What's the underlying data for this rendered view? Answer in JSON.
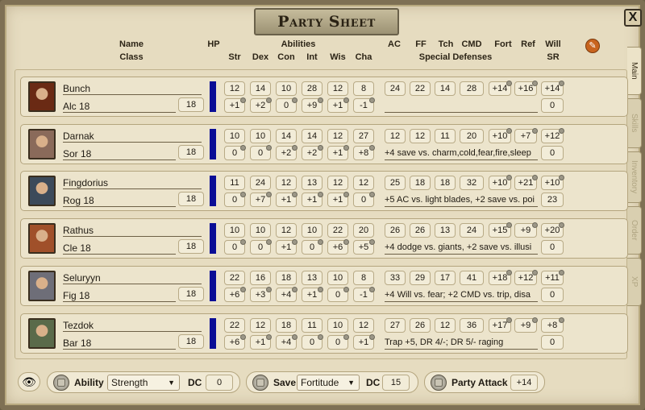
{
  "window": {
    "title": "Party Sheet",
    "close_label": "X"
  },
  "headers": {
    "name": "Name",
    "class": "Class",
    "hp": "HP",
    "abilities": "Abilities",
    "ability_cols": [
      "Str",
      "Dex",
      "Con",
      "Int",
      "Wis",
      "Cha"
    ],
    "ac": "AC",
    "ff": "FF",
    "tch": "Tch",
    "cmd": "CMD",
    "fort": "Fort",
    "ref": "Ref",
    "will": "Will",
    "special_defenses": "Special Defenses",
    "sr": "SR"
  },
  "tabs": [
    "Main",
    "Skills",
    "Inventory",
    "Order",
    "XP"
  ],
  "active_tab": "Main",
  "colors": {
    "hp_bar": "#0a0d96",
    "edit_button": "#c8641e"
  },
  "party": [
    {
      "name": "Bunch",
      "class": "Alc 18",
      "level": "18",
      "scores": [
        "12",
        "14",
        "10",
        "28",
        "12",
        "8"
      ],
      "mods": [
        "+1",
        "+2",
        "0",
        "+9",
        "+1",
        "-1"
      ],
      "ac": "24",
      "ff": "22",
      "tch": "14",
      "cmd": "28",
      "fort": "+14",
      "ref": "+16",
      "will": "+14",
      "special": "",
      "sr": "0"
    },
    {
      "name": "Darnak",
      "class": "Sor 18",
      "level": "18",
      "scores": [
        "10",
        "10",
        "14",
        "14",
        "12",
        "27"
      ],
      "mods": [
        "0",
        "0",
        "+2",
        "+2",
        "+1",
        "+8"
      ],
      "ac": "12",
      "ff": "12",
      "tch": "11",
      "cmd": "20",
      "fort": "+10",
      "ref": "+7",
      "will": "+12",
      "special": "+4 save vs. charm,cold,fear,fire,sleep",
      "sr": "0"
    },
    {
      "name": "Fingdorius",
      "class": "Rog 18",
      "level": "18",
      "scores": [
        "11",
        "24",
        "12",
        "13",
        "12",
        "12"
      ],
      "mods": [
        "0",
        "+7",
        "+1",
        "+1",
        "+1",
        "0"
      ],
      "ac": "25",
      "ff": "18",
      "tch": "18",
      "cmd": "32",
      "fort": "+10",
      "ref": "+21",
      "will": "+10",
      "special": "+5 AC vs. light blades, +2 save vs. poi",
      "sr": "23"
    },
    {
      "name": "Rathus",
      "class": "Cle 18",
      "level": "18",
      "scores": [
        "10",
        "10",
        "12",
        "10",
        "22",
        "20"
      ],
      "mods": [
        "0",
        "0",
        "+1",
        "0",
        "+6",
        "+5"
      ],
      "ac": "26",
      "ff": "26",
      "tch": "13",
      "cmd": "24",
      "fort": "+15",
      "ref": "+9",
      "will": "+20",
      "special": "+4 dodge vs. giants, +2 save vs. illusi",
      "sr": "0"
    },
    {
      "name": "Seluryyn",
      "class": "Fig 18",
      "level": "18",
      "scores": [
        "22",
        "16",
        "18",
        "13",
        "10",
        "8"
      ],
      "mods": [
        "+6",
        "+3",
        "+4",
        "+1",
        "0",
        "-1"
      ],
      "ac": "33",
      "ff": "29",
      "tch": "17",
      "cmd": "41",
      "fort": "+18",
      "ref": "+12",
      "will": "+11",
      "special": "+4 Will vs. fear; +2 CMD vs. trip, disa",
      "sr": "0"
    },
    {
      "name": "Tezdok",
      "class": "Bar 18",
      "level": "18",
      "scores": [
        "22",
        "12",
        "18",
        "11",
        "10",
        "12"
      ],
      "mods": [
        "+6",
        "+1",
        "+4",
        "0",
        "0",
        "+1"
      ],
      "ac": "27",
      "ff": "26",
      "tch": "12",
      "cmd": "36",
      "fort": "+17",
      "ref": "+9",
      "will": "+8",
      "special": "Trap +5, DR 4/-; DR 5/- raging",
      "sr": "0"
    }
  ],
  "footer": {
    "ability_label": "Ability",
    "ability_value": "Strength",
    "ability_dc_label": "DC",
    "ability_dc": "0",
    "save_label": "Save",
    "save_value": "Fortitude",
    "save_dc_label": "DC",
    "save_dc": "15",
    "attack_label": "Party Attack",
    "attack_value": "+14"
  }
}
